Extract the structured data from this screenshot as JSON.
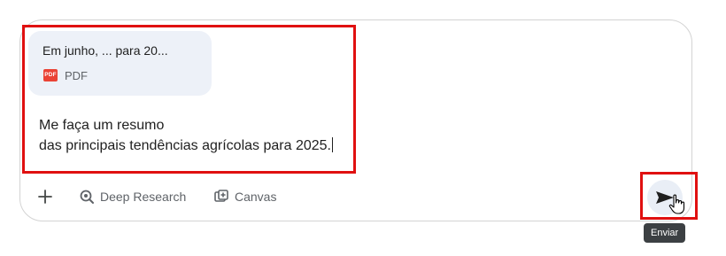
{
  "attachment": {
    "name": "Em junho, ... para 20...",
    "type_label": "PDF",
    "badge_text": "PDF"
  },
  "prompt": {
    "line1": "Me faça um resumo",
    "line2": "das principais tendências agrícolas para 2025."
  },
  "toolbar": {
    "deep_research_label": "Deep Research",
    "canvas_label": "Canvas"
  },
  "send": {
    "tooltip": "Enviar"
  },
  "colors": {
    "highlight": "#e01010",
    "pdf": "#ea4335",
    "attachment_bg": "#edf1f8"
  },
  "icons": [
    "plus-icon",
    "deep-research-icon",
    "canvas-icon",
    "send-arrow-icon",
    "hand-cursor-icon",
    "pdf-icon"
  ]
}
